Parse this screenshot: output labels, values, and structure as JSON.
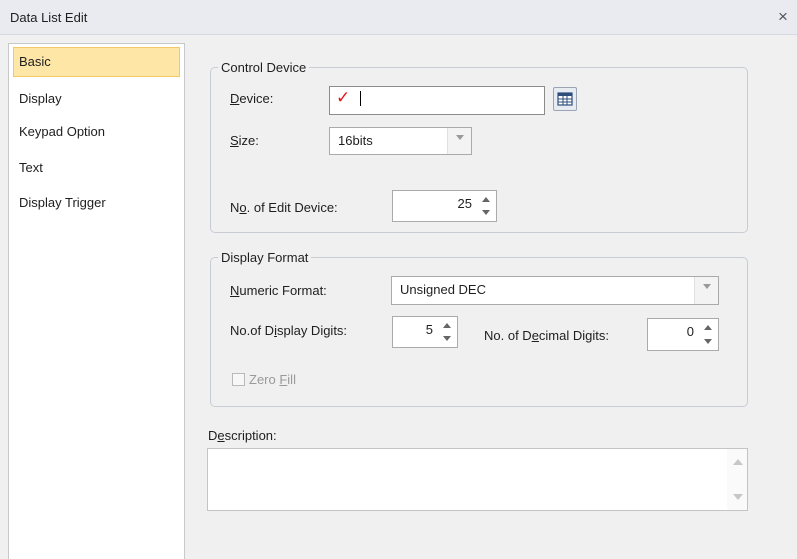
{
  "dialog": {
    "title": "Data List Edit",
    "close_glyph": "×",
    "close_icon": "close-icon"
  },
  "sidebar": {
    "items": [
      {
        "label": "Basic",
        "active": true
      },
      {
        "label": "Display",
        "active": false
      },
      {
        "label": "Keypad Option",
        "active": false
      },
      {
        "label": "Text",
        "active": false
      },
      {
        "label": "Display Trigger",
        "active": false
      }
    ]
  },
  "control_device": {
    "title": "Control Device",
    "device": {
      "label_ul": "D",
      "label_rest": "evice:",
      "value": "",
      "mark_glyph": "✓",
      "mark_icon": "red-check-mark-icon",
      "picker_icon": "device-picker-icon"
    },
    "size": {
      "label_ul": "S",
      "label_rest": "ize:",
      "value": "16bits"
    },
    "edit_device": {
      "label_pre": "N",
      "label_ul": "o",
      "label_rest": ". of Edit Device:",
      "value": "25"
    }
  },
  "display_format": {
    "title": "Display Format",
    "numeric_format": {
      "label_ul": "N",
      "label_rest": "umeric Format:",
      "value": "Unsigned DEC"
    },
    "display_digits": {
      "label_pre": "No.of D",
      "label_ul": "i",
      "label_rest": "splay Digits:",
      "value": "5"
    },
    "decimal_digits": {
      "label_pre": "No. of D",
      "label_ul": "e",
      "label_rest": "cimal Digits:",
      "value": "0"
    },
    "zero_fill": {
      "label_pre": "Zero ",
      "label_ul": "F",
      "label_rest": "ill",
      "checked": false,
      "enabled": false
    }
  },
  "description": {
    "label_pre": "D",
    "label_ul": "e",
    "label_rest": "scription:",
    "value": ""
  },
  "colors": {
    "accent_selected": "#fde6a6",
    "check_mark": "#e0161b"
  }
}
